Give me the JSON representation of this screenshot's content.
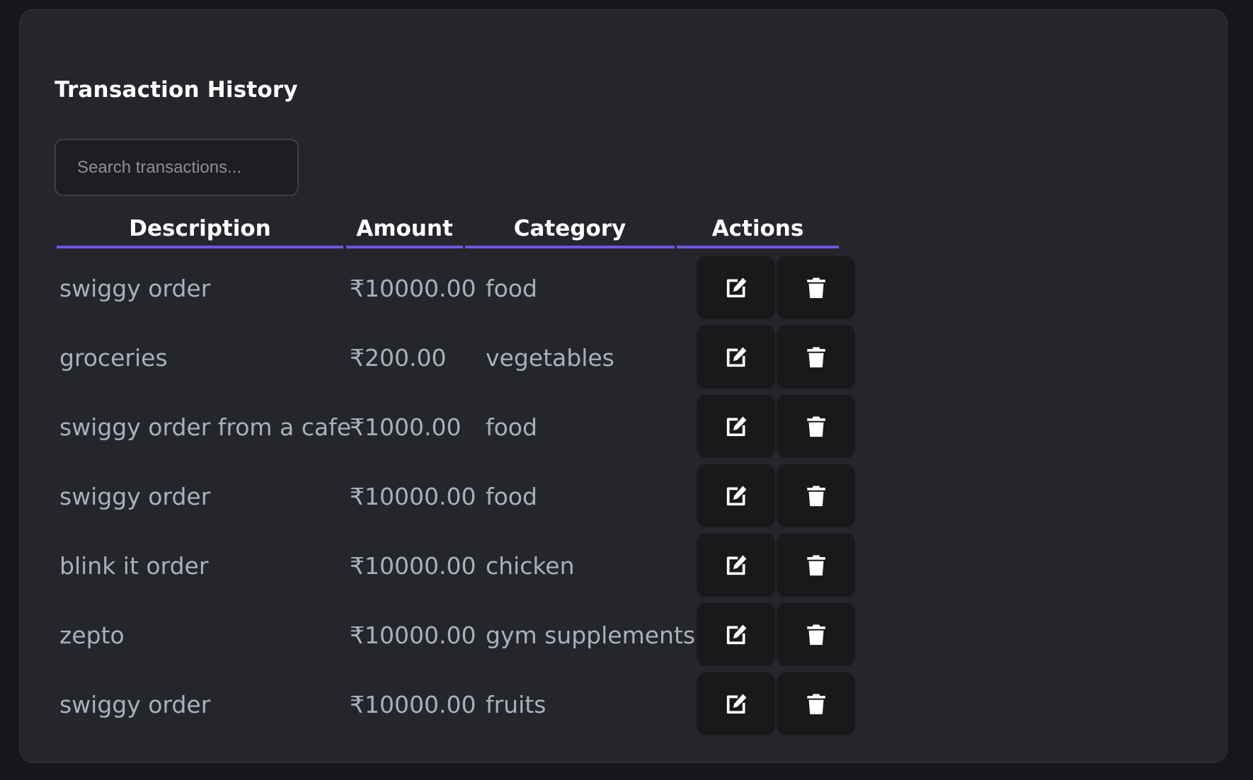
{
  "panel": {
    "title": "Transaction History",
    "search": {
      "placeholder": "Search transactions...",
      "value": ""
    },
    "columns": [
      "Description",
      "Amount",
      "Category",
      "Actions"
    ],
    "rows": [
      {
        "description": "swiggy order",
        "amount": "₹10000.00",
        "category": "food"
      },
      {
        "description": "groceries",
        "amount": "₹200.00",
        "category": "vegetables"
      },
      {
        "description": "swiggy order from a cafe",
        "amount": "₹1000.00",
        "category": "food"
      },
      {
        "description": "swiggy order",
        "amount": "₹10000.00",
        "category": "food"
      },
      {
        "description": "blink it order",
        "amount": "₹10000.00",
        "category": "chicken"
      },
      {
        "description": "zepto",
        "amount": "₹10000.00",
        "category": "gym supplements"
      },
      {
        "description": "swiggy order",
        "amount": "₹10000.00",
        "category": "fruits"
      }
    ],
    "row_action_icons": [
      "edit-icon",
      "trash-icon"
    ]
  },
  "colors": {
    "page_background": "#16171b",
    "card_background": "#25262b",
    "header_underline": "#7355e8",
    "action_button_background": "#19191b",
    "cell_text": "#aab0bb",
    "heading_text": "#ffffff"
  }
}
